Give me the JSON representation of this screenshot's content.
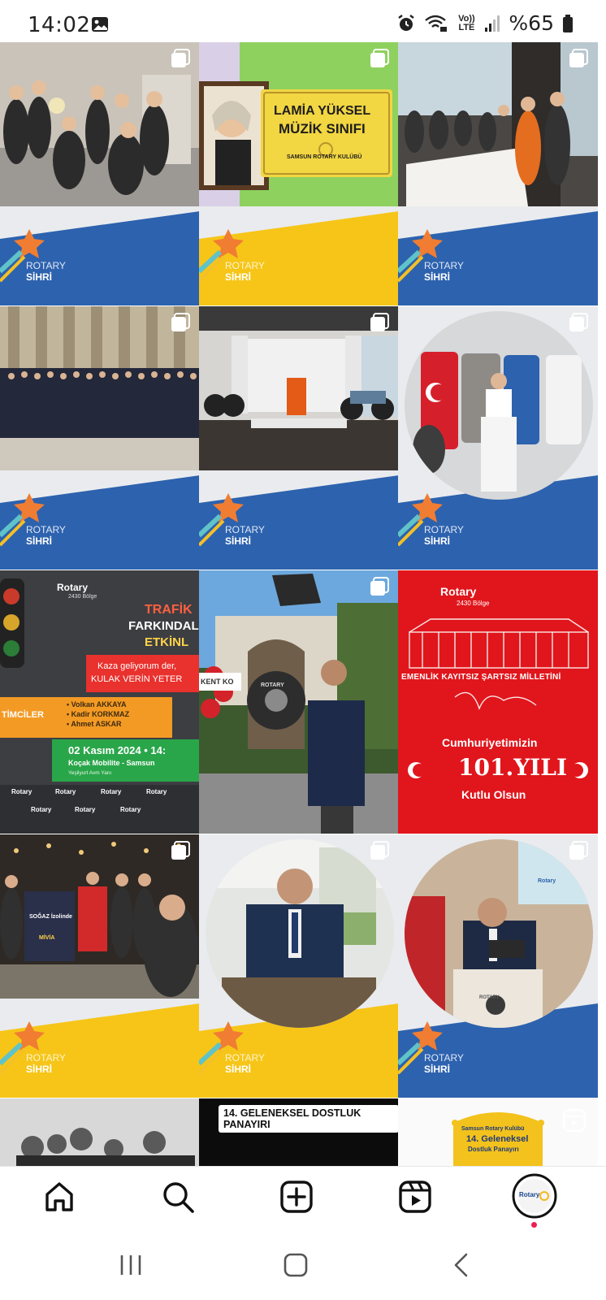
{
  "status_bar": {
    "time": "14:02",
    "network": "Vo)) LTE",
    "battery": "%65",
    "icons": [
      "gallery-icon",
      "alarm-icon",
      "wifi-calling-icon",
      "signal-icon",
      "battery-icon"
    ]
  },
  "posts": [
    {
      "kind": "photo",
      "band_color": "#2d62ae",
      "logo_line1": "ROTARY",
      "logo_line2": "SİHRİ"
    },
    {
      "kind": "photo",
      "band_color": "#f6c518",
      "logo_line1": "ROTARY",
      "logo_line2": "SİHRİ",
      "sign_line1": "LAMİA YÜKSEL",
      "sign_line2": "MÜZİK SINIFI",
      "sign_line3": "SAMSUN ROTARY KULÜBÜ"
    },
    {
      "kind": "photo",
      "band_color": "#2d62ae",
      "logo_line1": "ROTARY",
      "logo_line2": "SİHRİ"
    },
    {
      "kind": "photo",
      "band_color": "#2d62ae",
      "logo_line1": "ROTARY",
      "logo_line2": "SİHRİ"
    },
    {
      "kind": "photo",
      "band_color": "#2d62ae",
      "logo_line1": "ROTARY",
      "logo_line2": "SİHRİ"
    },
    {
      "kind": "circle",
      "band_color": "#2d62ae",
      "logo_line1": "ROTARY",
      "logo_line2": "SİHRİ"
    },
    {
      "kind": "poster",
      "brand": "Rotary",
      "region": "2430 Bölge",
      "heading1": "TRAFİK",
      "heading2": "FARKINDAL",
      "heading3": "ETKİNL",
      "quote1": "Kaza geliyorum der,",
      "quote2": "KULAK VERİN YETER",
      "label": "TİMCİLER",
      "names": [
        "• Volkan AKKAYA",
        "• Kadir KORKMAZ",
        "• Ahmet ASKAR"
      ],
      "date": "02 Kasım 2024 • 14:",
      "place": "Koçak Mobilite - Samsun",
      "place_sub": "Yeşilyurt Avm Yanı",
      "club_logo": "Rotary"
    },
    {
      "kind": "photo_full",
      "wreath_text": "KENT KO",
      "wreath_text2": "ROTARY"
    },
    {
      "kind": "red_poster",
      "brand": "Rotary",
      "region": "2430 Bölge",
      "motto": "EMENLİK KAYITSIZ ŞARTSIZ MİLLETİNİ",
      "line1": "Cumhuriyetimizin",
      "line2": "101.YILI",
      "line3": "Kutlu Olsun"
    },
    {
      "kind": "photo",
      "band_color": "#f6c518",
      "logo_line1": "ROTARY",
      "logo_line2": "SİHRİ",
      "poster_title": "SOĞAZ İzolinde",
      "poster_sub": "MİVİA"
    },
    {
      "kind": "circle",
      "band_color": "#f6c518",
      "logo_line1": "ROTARY",
      "logo_line2": "SİHRİ"
    },
    {
      "kind": "circle",
      "band_color": "#2d62ae",
      "logo_line1": "ROTARY",
      "logo_line2": "SİHRİ",
      "podium_text": "ROTARY",
      "screen_text": "Rotary"
    },
    {
      "kind": "partial_bw"
    },
    {
      "kind": "partial_black",
      "title": "14. GELENEKSEL DOSTLUK PANAYIRI"
    },
    {
      "kind": "partial_fair",
      "line1": "Samsun Rotary Kulübü",
      "line2": "14. Geleneksel",
      "line3": "Dostluk Panayırı"
    }
  ],
  "bottom_nav": {
    "items": [
      "home-icon",
      "search-icon",
      "create-icon",
      "reels-icon",
      "profile-avatar"
    ],
    "profile_label": "Rotary"
  },
  "system_nav": [
    "recents-button",
    "home-button",
    "back-button"
  ]
}
